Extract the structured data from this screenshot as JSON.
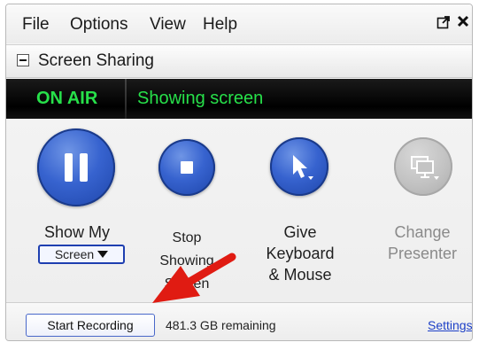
{
  "menu": {
    "items": [
      "File",
      "Options",
      "View",
      "Help"
    ],
    "popout_icon": "popout-icon",
    "close_icon": "close-icon"
  },
  "section": {
    "title": "Screen Sharing",
    "collapse_icon": "collapse-minus-icon"
  },
  "status": {
    "state": "ON AIR",
    "message": "Showing screen",
    "color": "#27e04a"
  },
  "actions": {
    "show_my": {
      "label": "Show My",
      "select_value": "Screen",
      "icon": "pause-icon"
    },
    "stop": {
      "line1": "Stop",
      "line2": "Showing",
      "line3": "Screen",
      "icon": "stop-icon"
    },
    "give": {
      "line1": "Give",
      "line2": "Keyboard",
      "line3": "& Mouse",
      "icon": "mouse-pointer-icon"
    },
    "change": {
      "line1": "Change",
      "line2": "Presenter",
      "icon": "presenter-screen-icon",
      "disabled": true
    }
  },
  "bottom": {
    "record_label": "Start Recording",
    "remaining": "481.3 GB remaining",
    "settings_label": "Settings"
  },
  "annotation": {
    "arrow_color": "#e01b12",
    "icon": "red-arrow-icon"
  },
  "colors": {
    "accent": "#3763cf",
    "link": "#1c3fc7"
  }
}
